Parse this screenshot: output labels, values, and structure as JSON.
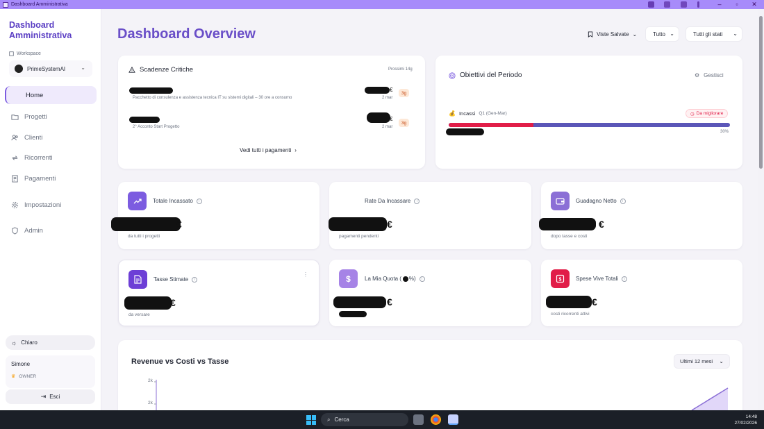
{
  "window": {
    "title": "Dashboard Amministrativa"
  },
  "sidebar": {
    "brand": "Dashboard Amministrativa",
    "workspace_label": "Workspace",
    "workspace_name": "PrimeSystemAI",
    "items": [
      {
        "label": "Home",
        "icon": "home-icon"
      },
      {
        "label": "Progetti",
        "icon": "folder-icon"
      },
      {
        "label": "Clienti",
        "icon": "users-icon"
      },
      {
        "label": "Ricorrenti",
        "icon": "repeat-icon"
      },
      {
        "label": "Pagamenti",
        "icon": "receipt-icon"
      },
      {
        "label": "Impostazioni",
        "icon": "gear-icon"
      },
      {
        "label": "Admin",
        "icon": "shield-icon"
      }
    ],
    "theme_label": "Chiaro",
    "user_name": "Simone",
    "user_role": "OWNER",
    "logout_label": "Esci"
  },
  "header": {
    "title": "Dashboard Overview",
    "saved_views_label": "Viste Salvate",
    "filter_scope": "Tutto",
    "filter_status": "Tutti gli stati"
  },
  "deadlines": {
    "title": "Scadenze Critiche",
    "range_label": "Prossimi 14g",
    "items": [
      {
        "description": "Pacchetto di consulenza e assistenza tecnica IT su sistemi digitali – 30 ore a consumo",
        "currency": "€",
        "date": "2 mar",
        "badge": "3g"
      },
      {
        "description": "2° Acconto Start Progetto",
        "currency": "€",
        "date": "2 mar",
        "badge": "3g"
      }
    ],
    "see_all_label": "Vedi tutti i pagamenti"
  },
  "goals": {
    "title": "Obiettivi del Periodo",
    "manage_label": "Gestisci",
    "goal_name": "Incassi",
    "goal_period": "Q1 (Gen-Mar)",
    "status_badge": "Da migliorare",
    "progress": 0.3,
    "progress_label": "30%",
    "colors": {
      "fill": "#e11d48",
      "track": "#5b56b8"
    }
  },
  "kpis": [
    {
      "label": "Totale Incassato",
      "currency": "€",
      "sub": "da tutti i progetti",
      "icon": "trending-up-icon",
      "color": "#7c5ce0"
    },
    {
      "label": "Rate Da Incassare",
      "currency": "€",
      "sub": "pagamenti pendenti",
      "icon": "calendar-icon",
      "color": "#ffffff"
    },
    {
      "label": "Guadagno Netto",
      "currency": "€",
      "sub": "dopo tasse e costi",
      "icon": "wallet-icon",
      "color": "#8b6fd6"
    },
    {
      "label": "Tasse Stimate",
      "currency": "€",
      "sub": "da versare",
      "icon": "document-icon",
      "color": "#6d3fd6"
    },
    {
      "label": "La Mia Quota (",
      "label_suffix": "%)",
      "currency": "€",
      "sub": "",
      "icon": "dollar-icon",
      "color": "#a683e6"
    },
    {
      "label": "Spese Vive Totali",
      "currency": "€",
      "sub": "costi ricorrenti attivi",
      "icon": "cash-icon",
      "color": "#e11d48"
    }
  ],
  "revenue_chart": {
    "title": "Revenue vs Costi vs Tasse",
    "period": "Ultimi 12 mesi",
    "y_ticks": [
      "2k",
      "2k"
    ]
  },
  "taskbar": {
    "search_label": "Cerca",
    "time": "14:48",
    "date": "27/02/2026"
  }
}
